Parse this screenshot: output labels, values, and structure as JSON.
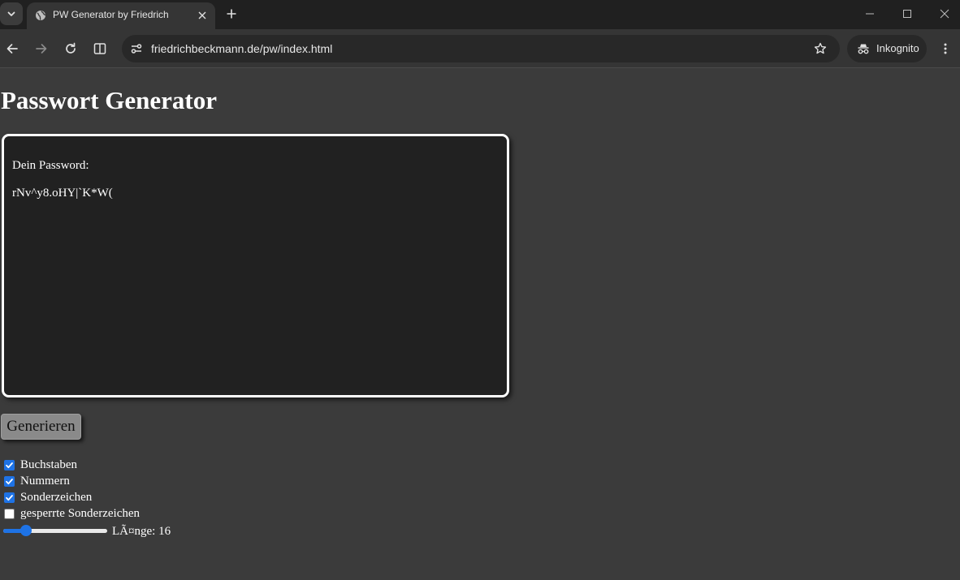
{
  "browser": {
    "tab_title": "PW Generator by Friedrich",
    "url": "friedrichbeckmann.de/pw/index.html",
    "profile_label": "Inkognito",
    "icons": [
      "chevron-down-icon",
      "globe-icon",
      "close-icon",
      "plus-icon",
      "minimize-icon",
      "maximize-icon",
      "back-icon",
      "forward-icon",
      "reload-icon",
      "split-view-icon",
      "site-info-icon",
      "star-icon",
      "incognito-icon",
      "more-icon"
    ]
  },
  "page": {
    "title": "Passwort Generator",
    "password_label": "Dein Password:",
    "password_value": "rNv^y8.oHY|`K*W(",
    "generate_label": "Generieren",
    "options": [
      {
        "label": "Buchstaben",
        "checked": true
      },
      {
        "label": "Nummern",
        "checked": true
      },
      {
        "label": "Sonderzeichen",
        "checked": true
      },
      {
        "label": "gesperrte Sonderzeichen",
        "checked": false
      }
    ],
    "length_label": "LÃ¤nge: 16",
    "length_slider_fraction": 0.18
  },
  "colors": {
    "accent": "#1e73e6",
    "page_bg": "#3b3b3b",
    "box_bg": "#212121"
  }
}
